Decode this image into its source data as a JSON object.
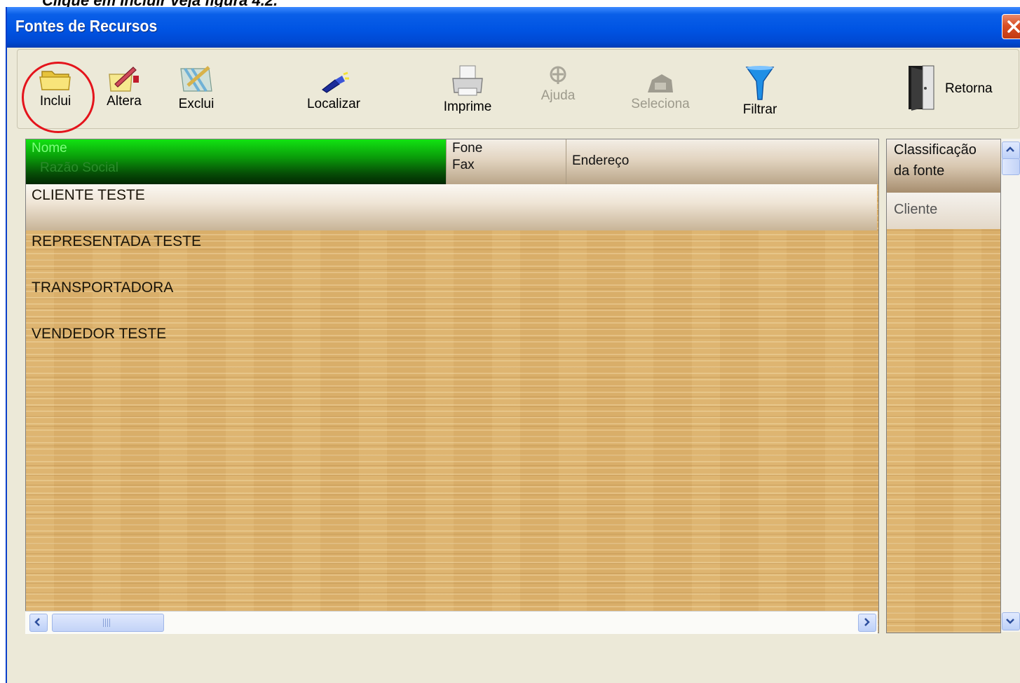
{
  "document": {
    "caption": "Clique em Incluir veja figura 4.2."
  },
  "window": {
    "title": "Fontes de Recursos"
  },
  "toolbar": {
    "items": [
      {
        "label": "Inclui",
        "icon": "folder-icon",
        "enabled": true
      },
      {
        "label": "Altera",
        "icon": "edit-icon",
        "enabled": true
      },
      {
        "label": "Exclui",
        "icon": "delete-icon",
        "enabled": true
      },
      {
        "label": "Localizar",
        "icon": "flashlight-icon",
        "enabled": true
      },
      {
        "label": "Imprime",
        "icon": "printer-icon",
        "enabled": true
      },
      {
        "label": "Ajuda",
        "icon": "help-icon",
        "enabled": false
      },
      {
        "label": "Seleciona",
        "icon": "select-icon",
        "enabled": false
      },
      {
        "label": "Filtrar",
        "icon": "funnel-icon",
        "enabled": true
      },
      {
        "label": "Retorna",
        "icon": "exit-door-icon",
        "enabled": true
      }
    ]
  },
  "grid": {
    "columns": [
      {
        "line1": "Nome",
        "line2": "Razão Social"
      },
      {
        "line1": "Fone",
        "line2": "Fax"
      },
      {
        "line1": "Endereço",
        "line2": ""
      }
    ],
    "rows": [
      {
        "name": "CLIENTE TESTE"
      },
      {
        "name": "REPRESENTADA TESTE"
      },
      {
        "name": "TRANSPORTADORA"
      },
      {
        "name": "VENDEDOR TESTE"
      }
    ]
  },
  "side_grid": {
    "header_line1": "Classificação",
    "header_line2": "da fonte",
    "current_value": "Cliente"
  },
  "colors": {
    "title_bar": "#0054e3",
    "selected_header": "#0a9c0a",
    "highlight_ring": "#e4141c"
  }
}
